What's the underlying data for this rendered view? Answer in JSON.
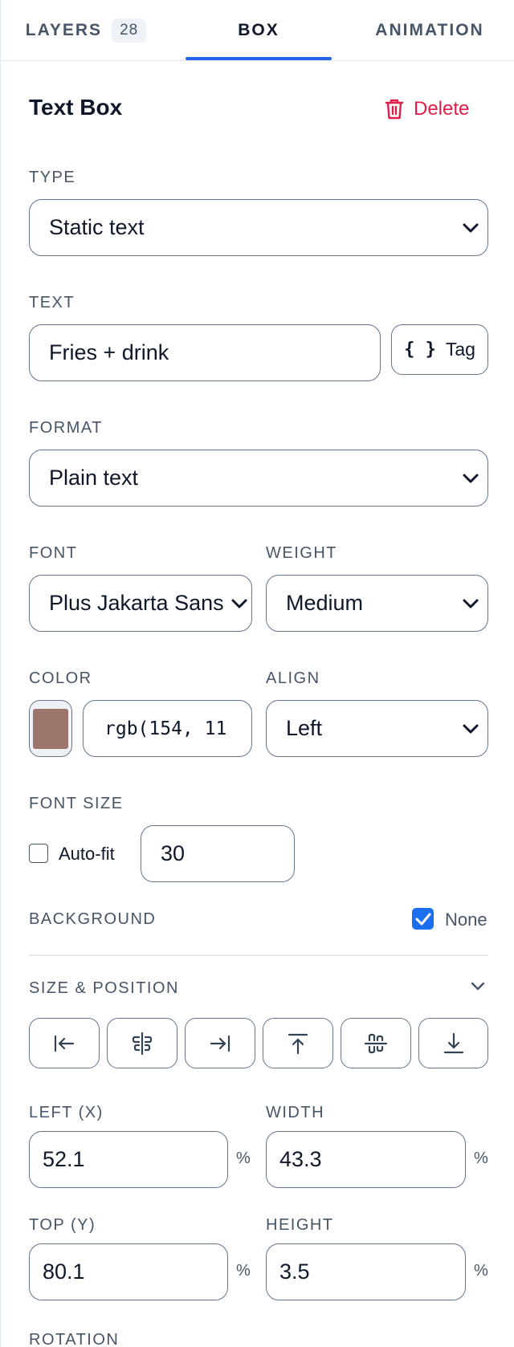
{
  "tabs": {
    "layers_label": "LAYERS",
    "layers_count": "28",
    "box_label": "BOX",
    "animation_label": "ANIMATION",
    "active": "BOX"
  },
  "header": {
    "title": "Text Box",
    "delete_label": "Delete"
  },
  "type": {
    "label": "TYPE",
    "value": "Static text"
  },
  "text": {
    "label": "TEXT",
    "value": "Fries + drink",
    "tag_label": "Tag",
    "tag_icon": "{ }"
  },
  "format": {
    "label": "FORMAT",
    "value": "Plain text"
  },
  "font": {
    "label": "FONT",
    "value": "Plus Jakarta Sans"
  },
  "weight": {
    "label": "WEIGHT",
    "value": "Medium"
  },
  "color": {
    "label": "COLOR",
    "value": "rgb(154, 11",
    "swatch": "#9a766c"
  },
  "align": {
    "label": "ALIGN",
    "value": "Left"
  },
  "font_size": {
    "label": "FONT SIZE",
    "autofit_label": "Auto-fit",
    "autofit_checked": false,
    "value": "30"
  },
  "background": {
    "label": "BACKGROUND",
    "none_label": "None",
    "none_checked": true
  },
  "size_position": {
    "label": "SIZE & POSITION",
    "align_buttons": [
      "align-left",
      "align-center-horizontal",
      "align-right",
      "align-top",
      "align-middle-vertical",
      "align-bottom"
    ]
  },
  "left": {
    "label": "LEFT (X)",
    "value": "52.1",
    "unit": "%"
  },
  "width": {
    "label": "WIDTH",
    "value": "43.3",
    "unit": "%"
  },
  "top": {
    "label": "TOP (Y)",
    "value": "80.1",
    "unit": "%"
  },
  "height": {
    "label": "HEIGHT",
    "value": "3.5",
    "unit": "%"
  },
  "rotation": {
    "label": "ROTATION"
  },
  "colors": {
    "accent": "#2563eb",
    "danger": "#e11d48",
    "checkbox": "#1d6ff2"
  }
}
